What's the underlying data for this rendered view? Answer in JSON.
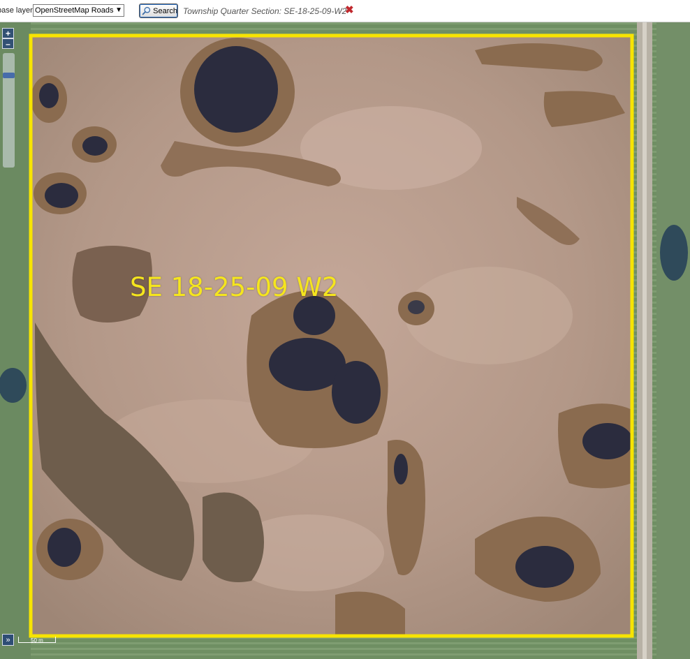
{
  "toolbar": {
    "base_layer_label": "base layer:",
    "base_layer_value": "OpenStreetMap Roads",
    "search_label": "Search",
    "section_title": "Township Quarter Section: SE-18-25-09-W2",
    "close_symbol": "✖"
  },
  "map": {
    "parcel_label": "SE 18-25-09 W2",
    "boundary_color": "#f7e400",
    "zoom_in": "+",
    "zoom_out": "–",
    "expand_symbol": "»",
    "scale_label": "50 m"
  },
  "icons": [
    "search-icon",
    "close-icon",
    "zoom-in-icon",
    "zoom-out-icon",
    "expand-icon"
  ]
}
